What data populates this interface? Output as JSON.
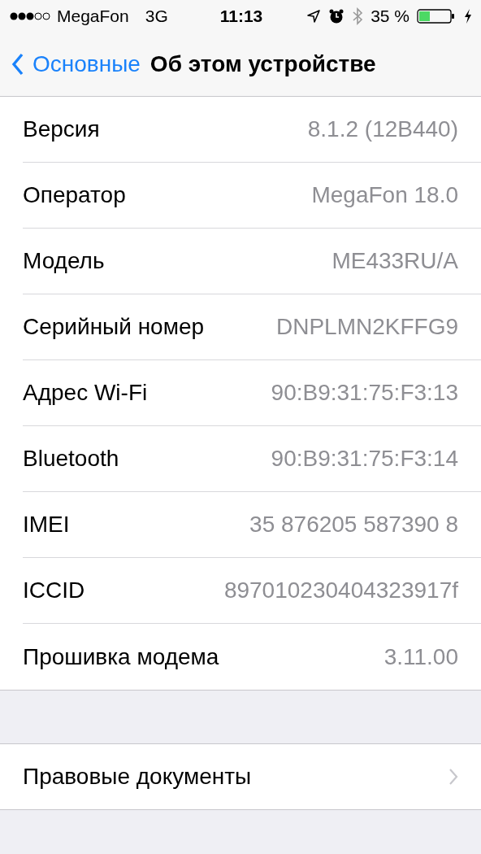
{
  "status_bar": {
    "carrier": "MegaFon",
    "network": "3G",
    "time": "11:13",
    "battery_percent": "35 %"
  },
  "nav": {
    "back": "Основные",
    "title": "Об этом устройстве"
  },
  "info_rows": [
    {
      "label": "Версия",
      "value": "8.1.2 (12B440)"
    },
    {
      "label": "Оператор",
      "value": "MegaFon 18.0"
    },
    {
      "label": "Модель",
      "value": "ME433RU/A"
    },
    {
      "label": "Серийный номер",
      "value": "DNPLMN2KFFG9"
    },
    {
      "label": "Адрес Wi-Fi",
      "value": "90:B9:31:75:F3:13"
    },
    {
      "label": "Bluetooth",
      "value": "90:B9:31:75:F3:14"
    },
    {
      "label": "IMEI",
      "value": "35 876205 587390 8"
    },
    {
      "label": "ICCID",
      "value": "897010230404323917f"
    },
    {
      "label": "Прошивка модема",
      "value": "3.11.00"
    }
  ],
  "links": [
    {
      "label": "Правовые документы"
    }
  ]
}
